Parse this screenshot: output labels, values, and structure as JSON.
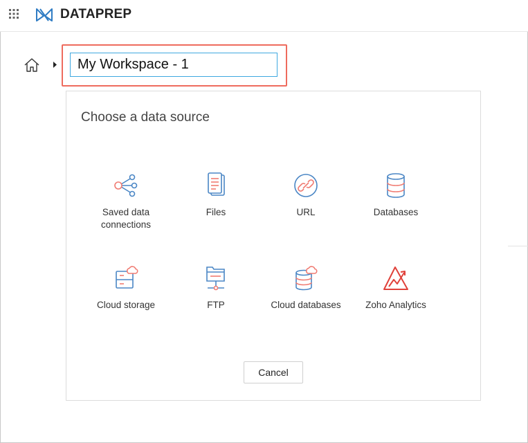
{
  "app": {
    "title": "DATAPREP"
  },
  "workspace": {
    "name_value": "My Workspace - 1"
  },
  "dialog": {
    "title": "Choose a data source",
    "cancel_label": "Cancel",
    "sources": [
      {
        "label": "Saved data connections",
        "icon": "share-icon"
      },
      {
        "label": "Files",
        "icon": "file-icon"
      },
      {
        "label": "URL",
        "icon": "link-icon"
      },
      {
        "label": "Databases",
        "icon": "database-icon"
      },
      {
        "label": "Cloud storage",
        "icon": "cloud-storage-icon"
      },
      {
        "label": "FTP",
        "icon": "ftp-icon"
      },
      {
        "label": "Cloud databases",
        "icon": "cloud-database-icon"
      },
      {
        "label": "Zoho Analytics",
        "icon": "zoho-analytics-icon"
      }
    ]
  },
  "colors": {
    "icon_blue": "#4a86c5",
    "icon_red": "#f07b72",
    "analytics_red": "#e0413a",
    "highlight": "#ee6b5d",
    "input_border": "#3ea8e0"
  }
}
